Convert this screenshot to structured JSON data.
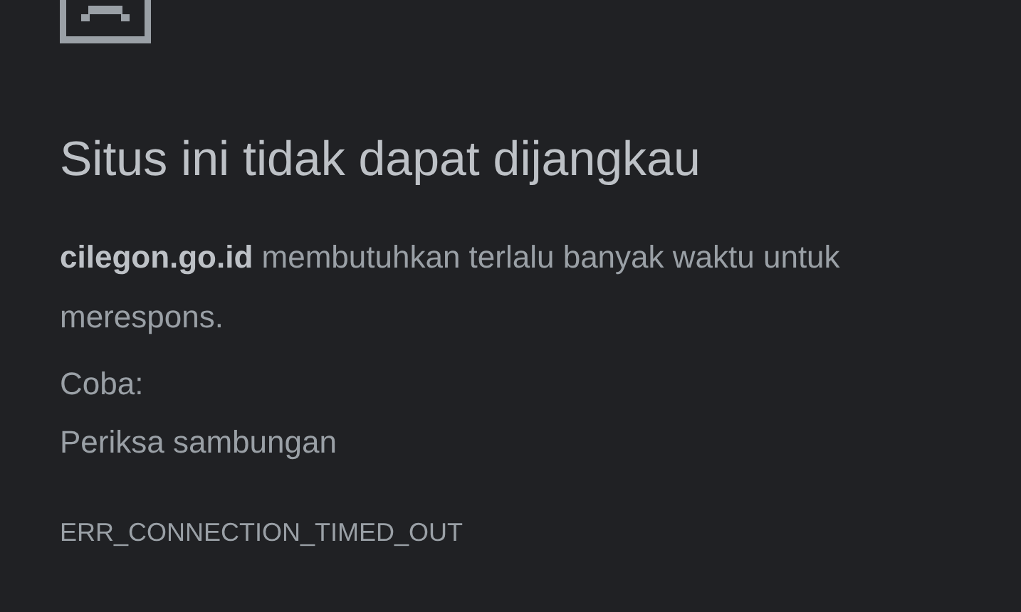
{
  "heading": "Situs ini tidak dapat dijangkau",
  "message": "**cilegon.go.id** membutuhkan terlalu banyak waktu untuk merespons.",
  "suggestions_label": "Coba:",
  "suggestions": [
    "Periksa sambungan"
  ],
  "error_code": "ERR_CONNECTION_TIMED_OUT"
}
